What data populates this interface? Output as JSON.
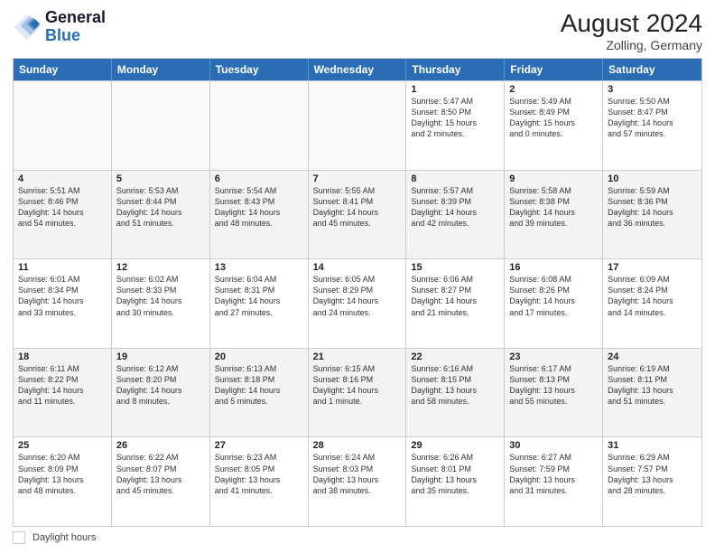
{
  "header": {
    "logo_line1": "General",
    "logo_line2": "Blue",
    "month_year": "August 2024",
    "location": "Zolling, Germany"
  },
  "days_of_week": [
    "Sunday",
    "Monday",
    "Tuesday",
    "Wednesday",
    "Thursday",
    "Friday",
    "Saturday"
  ],
  "legend": {
    "label": "Daylight hours"
  },
  "weeks": [
    [
      {
        "day": "",
        "text": ""
      },
      {
        "day": "",
        "text": ""
      },
      {
        "day": "",
        "text": ""
      },
      {
        "day": "",
        "text": ""
      },
      {
        "day": "1",
        "text": "Sunrise: 5:47 AM\nSunset: 8:50 PM\nDaylight: 15 hours\nand 2 minutes."
      },
      {
        "day": "2",
        "text": "Sunrise: 5:49 AM\nSunset: 8:49 PM\nDaylight: 15 hours\nand 0 minutes."
      },
      {
        "day": "3",
        "text": "Sunrise: 5:50 AM\nSunset: 8:47 PM\nDaylight: 14 hours\nand 57 minutes."
      }
    ],
    [
      {
        "day": "4",
        "text": "Sunrise: 5:51 AM\nSunset: 8:46 PM\nDaylight: 14 hours\nand 54 minutes."
      },
      {
        "day": "5",
        "text": "Sunrise: 5:53 AM\nSunset: 8:44 PM\nDaylight: 14 hours\nand 51 minutes."
      },
      {
        "day": "6",
        "text": "Sunrise: 5:54 AM\nSunset: 8:43 PM\nDaylight: 14 hours\nand 48 minutes."
      },
      {
        "day": "7",
        "text": "Sunrise: 5:55 AM\nSunset: 8:41 PM\nDaylight: 14 hours\nand 45 minutes."
      },
      {
        "day": "8",
        "text": "Sunrise: 5:57 AM\nSunset: 8:39 PM\nDaylight: 14 hours\nand 42 minutes."
      },
      {
        "day": "9",
        "text": "Sunrise: 5:58 AM\nSunset: 8:38 PM\nDaylight: 14 hours\nand 39 minutes."
      },
      {
        "day": "10",
        "text": "Sunrise: 5:59 AM\nSunset: 8:36 PM\nDaylight: 14 hours\nand 36 minutes."
      }
    ],
    [
      {
        "day": "11",
        "text": "Sunrise: 6:01 AM\nSunset: 8:34 PM\nDaylight: 14 hours\nand 33 minutes."
      },
      {
        "day": "12",
        "text": "Sunrise: 6:02 AM\nSunset: 8:33 PM\nDaylight: 14 hours\nand 30 minutes."
      },
      {
        "day": "13",
        "text": "Sunrise: 6:04 AM\nSunset: 8:31 PM\nDaylight: 14 hours\nand 27 minutes."
      },
      {
        "day": "14",
        "text": "Sunrise: 6:05 AM\nSunset: 8:29 PM\nDaylight: 14 hours\nand 24 minutes."
      },
      {
        "day": "15",
        "text": "Sunrise: 6:06 AM\nSunset: 8:27 PM\nDaylight: 14 hours\nand 21 minutes."
      },
      {
        "day": "16",
        "text": "Sunrise: 6:08 AM\nSunset: 8:26 PM\nDaylight: 14 hours\nand 17 minutes."
      },
      {
        "day": "17",
        "text": "Sunrise: 6:09 AM\nSunset: 8:24 PM\nDaylight: 14 hours\nand 14 minutes."
      }
    ],
    [
      {
        "day": "18",
        "text": "Sunrise: 6:11 AM\nSunset: 8:22 PM\nDaylight: 14 hours\nand 11 minutes."
      },
      {
        "day": "19",
        "text": "Sunrise: 6:12 AM\nSunset: 8:20 PM\nDaylight: 14 hours\nand 8 minutes."
      },
      {
        "day": "20",
        "text": "Sunrise: 6:13 AM\nSunset: 8:18 PM\nDaylight: 14 hours\nand 5 minutes."
      },
      {
        "day": "21",
        "text": "Sunrise: 6:15 AM\nSunset: 8:16 PM\nDaylight: 14 hours\nand 1 minute."
      },
      {
        "day": "22",
        "text": "Sunrise: 6:16 AM\nSunset: 8:15 PM\nDaylight: 13 hours\nand 58 minutes."
      },
      {
        "day": "23",
        "text": "Sunrise: 6:17 AM\nSunset: 8:13 PM\nDaylight: 13 hours\nand 55 minutes."
      },
      {
        "day": "24",
        "text": "Sunrise: 6:19 AM\nSunset: 8:11 PM\nDaylight: 13 hours\nand 51 minutes."
      }
    ],
    [
      {
        "day": "25",
        "text": "Sunrise: 6:20 AM\nSunset: 8:09 PM\nDaylight: 13 hours\nand 48 minutes."
      },
      {
        "day": "26",
        "text": "Sunrise: 6:22 AM\nSunset: 8:07 PM\nDaylight: 13 hours\nand 45 minutes."
      },
      {
        "day": "27",
        "text": "Sunrise: 6:23 AM\nSunset: 8:05 PM\nDaylight: 13 hours\nand 41 minutes."
      },
      {
        "day": "28",
        "text": "Sunrise: 6:24 AM\nSunset: 8:03 PM\nDaylight: 13 hours\nand 38 minutes."
      },
      {
        "day": "29",
        "text": "Sunrise: 6:26 AM\nSunset: 8:01 PM\nDaylight: 13 hours\nand 35 minutes."
      },
      {
        "day": "30",
        "text": "Sunrise: 6:27 AM\nSunset: 7:59 PM\nDaylight: 13 hours\nand 31 minutes."
      },
      {
        "day": "31",
        "text": "Sunrise: 6:29 AM\nSunset: 7:57 PM\nDaylight: 13 hours\nand 28 minutes."
      }
    ]
  ]
}
